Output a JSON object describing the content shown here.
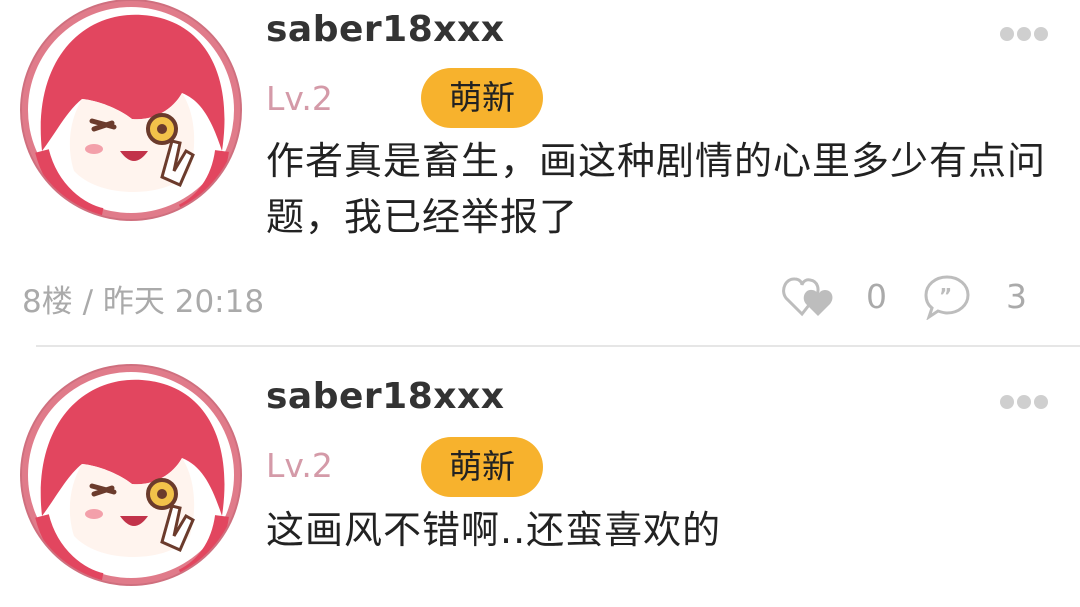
{
  "comments": [
    {
      "username": "saber18xxx",
      "level": "Lv.2",
      "badge": "萌新",
      "content": "作者真是畜生，画这种剧情的心里多少有点问题，我已经举报了",
      "floor_time": "8楼 / 昨天 20:18",
      "likes": "0",
      "replies": "3"
    },
    {
      "username": "saber18xxx",
      "level": "Lv.2",
      "badge": "萌新",
      "content": "这画风不错啊..还蛮喜欢的"
    }
  ],
  "icons": {
    "more": "more-dots-icon",
    "like": "heart-icon",
    "reply": "comment-bubble-icon"
  },
  "colors": {
    "badge": "#f7b22d",
    "level": "#d49aa8",
    "username": "#333333",
    "meta": "#aaaaaa"
  }
}
